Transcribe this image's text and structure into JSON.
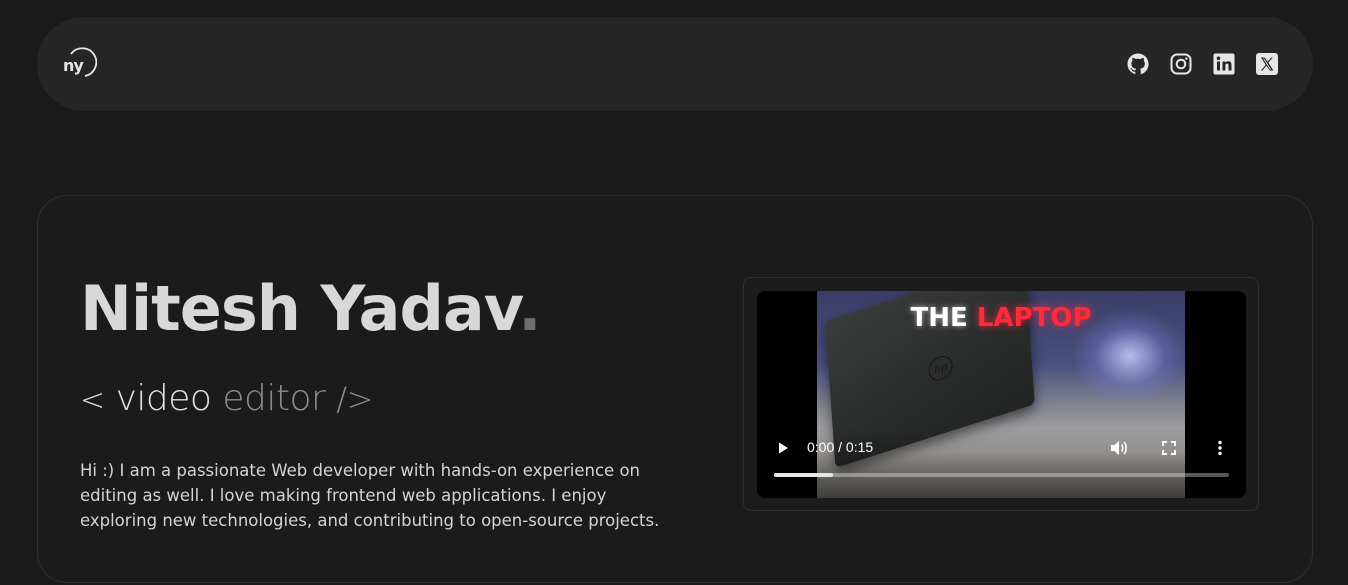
{
  "navbar": {
    "logo_text": "ny",
    "socials": [
      {
        "name": "github-icon"
      },
      {
        "name": "instagram-icon"
      },
      {
        "name": "linkedin-icon"
      },
      {
        "name": "x-icon"
      }
    ]
  },
  "hero": {
    "name": "Nitesh Yadav",
    "name_dot": ".",
    "role_open": "<",
    "role_word1": "video",
    "role_word2": "editor",
    "role_close": "/>",
    "bio": "Hi :) I am a passionate Web developer with hands-on experience on editing as well. I love making frontend web applications. I enjoy exploring new technologies, and contributing to open-source projects."
  },
  "video": {
    "thumbnail_title_1": "THE",
    "thumbnail_title_2": "LAPTOP",
    "time_display": "0:00 / 0:15",
    "progress": 0.13
  }
}
